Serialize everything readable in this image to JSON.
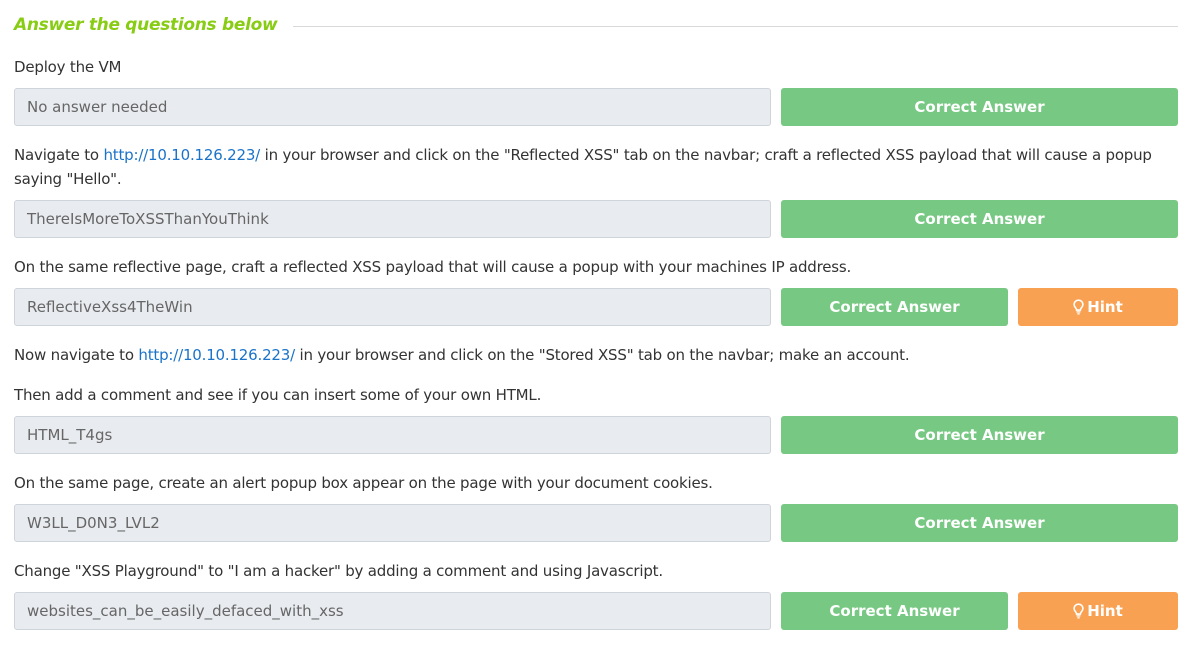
{
  "section": {
    "title": "Answer the questions below"
  },
  "colors": {
    "title_green": "#88cc14",
    "correct_green": "#76c882",
    "hint_orange": "#f9a152",
    "link_blue": "#1a73c9",
    "answer_bg": "#e8ebef"
  },
  "buttons": {
    "correct_label": "Correct Answer",
    "hint_label": "Hint",
    "hint_icon": "lightbulb-icon"
  },
  "questions": [
    {
      "text": "Deploy the VM",
      "answer": "No answer needed",
      "has_hint": false
    },
    {
      "text_before": "Navigate to ",
      "link": "http://10.10.126.223/",
      "text_after": " in your browser and click on the \"Reflected XSS\" tab on the navbar; craft a reflected XSS payload that will cause a popup saying \"Hello\".",
      "answer": "ThereIsMoreToXSSThanYouThink",
      "has_hint": false
    },
    {
      "text": "On the same reflective page, craft a reflected XSS payload that will cause a popup with your machines IP address.",
      "answer": "ReflectiveXss4TheWin",
      "has_hint": true
    },
    {
      "text_before": "Now navigate to ",
      "link": "http://10.10.126.223/",
      "text_after": " in your browser and click on the \"Stored XSS\" tab on the navbar; make an account.",
      "text_line2": "Then add a comment and see if you can insert some of your own HTML.",
      "answer": "HTML_T4gs",
      "has_hint": false
    },
    {
      "text": "On the same page, create an alert popup box appear on the page with your document cookies.",
      "answer": "W3LL_D0N3_LVL2",
      "has_hint": false
    },
    {
      "text": "Change \"XSS Playground\" to \"I am a hacker\" by adding a comment and using Javascript.",
      "answer": "websites_can_be_easily_defaced_with_xss",
      "has_hint": true
    }
  ]
}
